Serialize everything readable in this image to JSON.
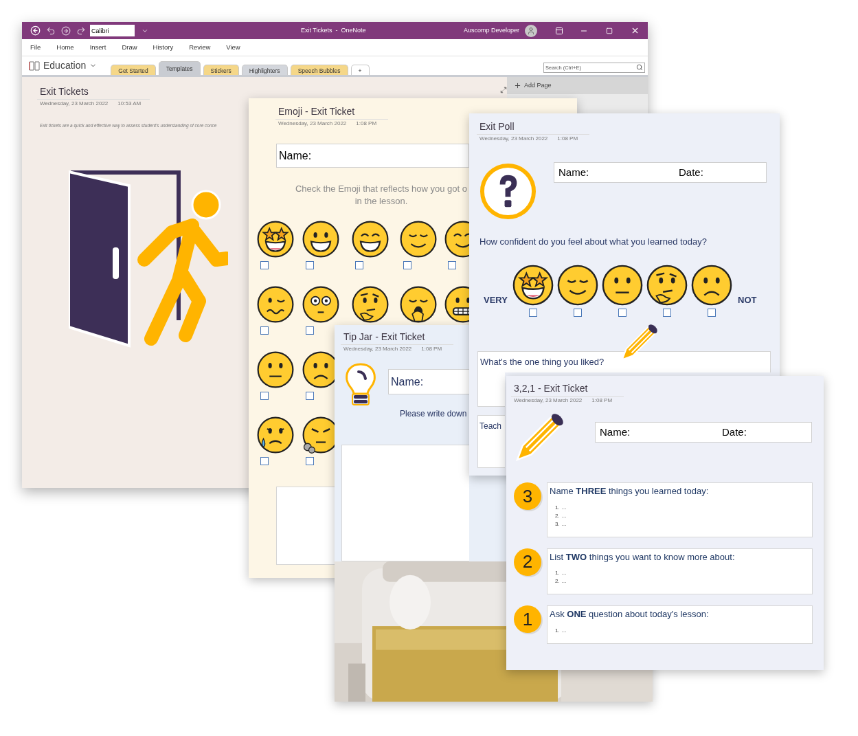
{
  "window": {
    "title": "Exit Tickets  -  OneNote",
    "font_box": "Calibri",
    "user": "Auscomp Developer"
  },
  "menu": [
    "File",
    "Home",
    "Insert",
    "Draw",
    "History",
    "Review",
    "View"
  ],
  "notebook": {
    "name": "Education"
  },
  "section_tabs": [
    {
      "label": "Get Started",
      "selected": false,
      "color": "#f5d788"
    },
    {
      "label": "Templates",
      "selected": true,
      "color": "#c9ccd2"
    },
    {
      "label": "Stickers",
      "selected": false,
      "color": "#f5d788"
    },
    {
      "label": "Highlighters",
      "selected": false,
      "color": "#d3d6dc"
    },
    {
      "label": "Speech Bubbles",
      "selected": false,
      "color": "#f5d788"
    },
    {
      "label": "+",
      "selected": false,
      "color": "#ffffff"
    }
  ],
  "search": {
    "placeholder": "Search (Ctrl+E)"
  },
  "add_page": "Add Page",
  "intro_page": {
    "title": "Exit Tickets",
    "date": "Wednesday, 23 March 2022",
    "time": "10:53 AM",
    "text": "Exit tickets are a quick and effective way to assess student's understanding of core conce"
  },
  "pages": [
    {
      "kind": "emoji",
      "title": "Emoji - Exit Ticket",
      "date": "Wednesday, 23 March 2022",
      "time": "1:08 PM",
      "name_label": "Name:",
      "instruction": [
        "Check the Emoji that reflects how you got o",
        "in the lesson."
      ],
      "emoji_rows": [
        [
          {
            "kind": "starstruck",
            "checked": false
          },
          {
            "kind": "grin",
            "checked": false
          },
          {
            "kind": "beam",
            "checked": false
          },
          {
            "kind": "relieved",
            "checked": false
          },
          {
            "kind": "smile",
            "checked": false
          }
        ],
        [
          {
            "kind": "woozy",
            "checked": false
          },
          {
            "kind": "flushed",
            "checked": false
          },
          {
            "kind": "thinking"
          },
          {
            "kind": "yawn"
          },
          {
            "kind": "grimace"
          }
        ],
        [
          {
            "kind": "neutral",
            "checked": false
          },
          {
            "kind": "frown",
            "checked": false
          }
        ],
        [
          {
            "kind": "sweat",
            "checked": false
          },
          {
            "kind": "steam",
            "checked": false
          }
        ]
      ]
    },
    {
      "kind": "tipjar",
      "title": "Tip Jar - Exit Ticket",
      "date": "Wednesday, 23 March 2022",
      "time": "1:08 PM",
      "name_label": "Name:",
      "instruction": "Please write down"
    },
    {
      "kind": "poll",
      "title": "Exit Poll",
      "date": "Wednesday, 23 March 2022",
      "time": "1:08 PM",
      "name_label": "Name:",
      "date_label": "Date:",
      "question": "How confident do you feel about what you learned today?",
      "scale_high": "VERY",
      "scale_low": "NOT",
      "emojis": [
        {
          "kind": "starstruck",
          "checked": false
        },
        {
          "kind": "relieved",
          "checked": false
        },
        {
          "kind": "neutral",
          "checked": false
        },
        {
          "kind": "thinking",
          "checked": false
        },
        {
          "kind": "frown",
          "checked": false
        }
      ],
      "liked_prompt": "What's the one thing you liked?",
      "teacher_prompt": "Teach"
    },
    {
      "kind": "three_two_one",
      "title": "3,2,1 - Exit Ticket",
      "date": "Wednesday, 23 March 2022",
      "time": "1:08 PM",
      "name_label": "Name:",
      "date_label": "Date:",
      "prompts": [
        {
          "badge": "3",
          "text": "Name **THREE** things you learned today:",
          "items": [
            "1. …",
            "2. …",
            "3. …"
          ]
        },
        {
          "badge": "2",
          "text": "List **TWO** things you want to know more about:",
          "items": [
            "1. …",
            "2. …"
          ]
        },
        {
          "badge": "1",
          "text": "Ask **ONE** question about today's lesson:",
          "items": [
            "1. …"
          ]
        }
      ]
    }
  ]
}
